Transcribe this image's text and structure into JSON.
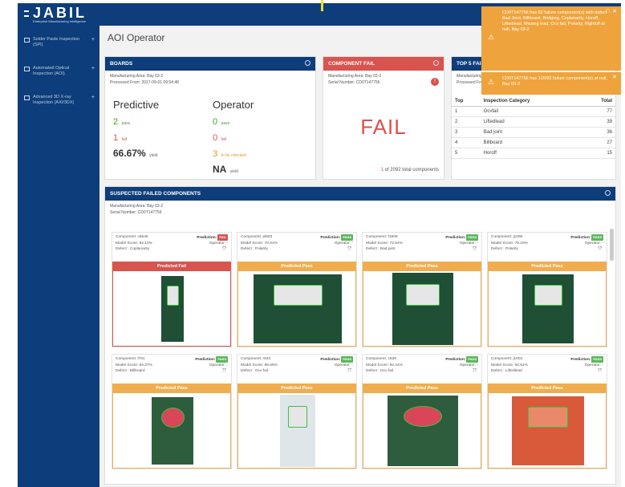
{
  "app": {
    "brand": "JABIL",
    "brand_sub": "Enterprise Manufacturing Intelligence",
    "page_title": "AOI Operator"
  },
  "sidebar": {
    "items": [
      {
        "label": "Solder Paste Inspection (SPI)"
      },
      {
        "label": "Automated Optical Inspection (AOI)"
      },
      {
        "label": "Advanced 3D X-ray Inspection (AXI/3DX)"
      }
    ]
  },
  "boards": {
    "title": "BOARDS",
    "area": "Manufacturing Area: Bay 03-2",
    "processed": "Processed From: 2017-09-01 09:54:48",
    "predictive": {
      "heading": "Predictive",
      "pass": "2",
      "pass_label": "pass",
      "fail": "1",
      "fail_label": "fail",
      "yield": "66.67%",
      "yield_label": "yield"
    },
    "operator": {
      "heading": "Operator",
      "pass": "0",
      "pass_label": "pass",
      "fail": "0",
      "fail_label": "fail",
      "check": "3",
      "check_label": "to be checked",
      "yield": "NA",
      "yield_label": "yield"
    }
  },
  "component_fail": {
    "title": "COMPONENT FAIL",
    "area": "Manufacturing Area: Bay 03-2",
    "serial": "Serial Number: CD0T147756",
    "status": "FAIL",
    "count": "1",
    "count_text": "of 2092 total components"
  },
  "top5": {
    "title": "TOP 5 FAILURE",
    "area": "Manufacturing Area: Bay 03-2",
    "processed": "Processed From: 2",
    "headers": {
      "top": "Top",
      "category": "Inspection Category",
      "total": "Total"
    },
    "rows": [
      {
        "rank": "1",
        "category": "Ocvfail",
        "total": "77"
      },
      {
        "rank": "2",
        "category": "Liftedlead",
        "total": "39"
      },
      {
        "rank": "3",
        "category": "Bad joint",
        "total": "36"
      },
      {
        "rank": "4",
        "category": "Billboard",
        "total": "27"
      },
      {
        "rank": "5",
        "category": "Horoff",
        "total": "15"
      }
    ]
  },
  "suspected": {
    "title": "SUSPECTED FAILED COMPONENTS",
    "area": "Manufacturing Area: Bay 03-2",
    "serial": "Serial Number: CD0T147756",
    "labels": {
      "component": "Component:",
      "prediction": "Prediction:",
      "model_score": "Model Score:",
      "operator": "Operator:",
      "defect": "Defect :",
      "operator_value": "-"
    },
    "tiles": [
      {
        "component": "c6545",
        "prediction": "FAIL",
        "model_score": "92.10%",
        "defect": "Coplanarity",
        "banner": "Predicted Fail",
        "pass": false
      },
      {
        "component": "pl603",
        "prediction": "PASS",
        "model_score": "70.01%",
        "defect": "Polarity",
        "banner": "Predicted Pass",
        "pass": true
      },
      {
        "component": "f1509",
        "prediction": "PASS",
        "model_score": "72.54%",
        "defect": "Bad joint",
        "banner": "Predicted Pass",
        "pass": true
      },
      {
        "component": "j1006",
        "prediction": "PASS",
        "model_score": "75.15%",
        "defect": "Polarity",
        "banner": "Predicted Pass",
        "pass": true
      },
      {
        "component": "l701",
        "prediction": "PASS",
        "model_score": "84.37%",
        "defect": "Billboard",
        "banner": "Predicted Pass",
        "pass": true
      },
      {
        "component": "r943",
        "prediction": "PASS",
        "model_score": "86.65%",
        "defect": "Ocv fail",
        "banner": "Predicted Pass",
        "pass": true
      },
      {
        "component": "c828",
        "prediction": "PASS",
        "model_score": "92.24%",
        "defect": "Ocv fail",
        "banner": "Predicted Pass",
        "pass": true
      },
      {
        "component": "j1003",
        "prediction": "PASS",
        "model_score": "92.81%",
        "defect": "Liftedlead",
        "banner": "Predicted Pass",
        "pass": true
      }
    ]
  },
  "notifications": [
    {
      "text": "CD0T147756 has 82 failure component(s) with defect Bad Joint, Billboard, Bridging, Coplanarity, Horoff, Liftedlead, Missing lead, Ocv fail, Polarity, Rightoff at null, Bay 03-2"
    },
    {
      "text": "CD0T147756 has 1/2092 failure component(s) at null, Bay 03-2"
    }
  ],
  "colors": {
    "brand": "#0d3d7a",
    "fail": "#d9534f",
    "pass": "#f0ad4e",
    "ok": "#5cb85c"
  }
}
